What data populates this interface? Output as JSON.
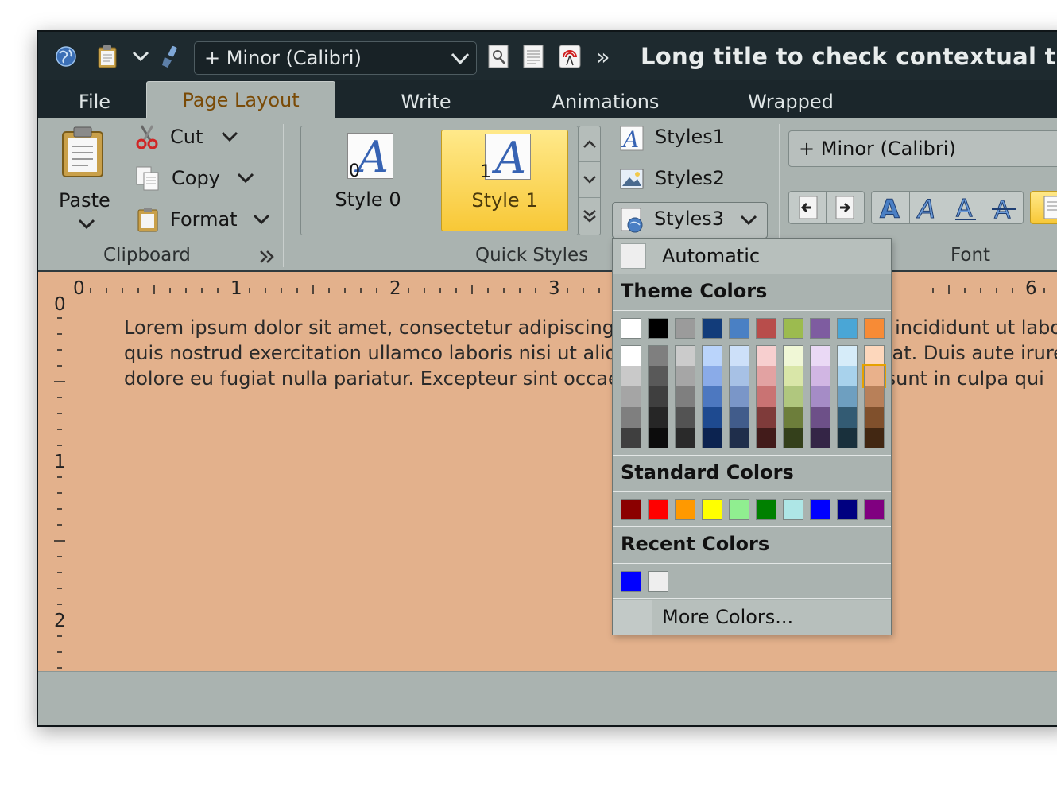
{
  "title_bar": {
    "font_combo": "+ Minor (Calibri)",
    "overflow": "»",
    "title": "Long title to check contextual tabs"
  },
  "tabs": [
    {
      "label": "File",
      "active": false
    },
    {
      "label": "Page Layout",
      "active": true
    },
    {
      "label": "Write",
      "active": false
    },
    {
      "label": "Animations",
      "active": false
    },
    {
      "label": "Wrapped",
      "active": false
    }
  ],
  "clipboard": {
    "paste": "Paste",
    "cut": "Cut",
    "copy": "Copy",
    "format": "Format",
    "group_label": "Clipboard"
  },
  "quick_styles": {
    "items": [
      {
        "num": "0",
        "label": "Style 0",
        "selected": false
      },
      {
        "num": "1",
        "label": "Style 1",
        "selected": true
      }
    ],
    "group_label": "Quick Styles"
  },
  "styles": {
    "styles1": "Styles1",
    "styles2": "Styles2",
    "styles3": "Styles3"
  },
  "font": {
    "combo": "+ Minor (Calibri)",
    "group_label": "Font"
  },
  "ruler": {
    "h_numbers": [
      "0",
      "1",
      "2",
      "3",
      "6"
    ],
    "v_numbers": [
      "0",
      "1",
      "2"
    ]
  },
  "document": {
    "lines": [
      "Lorem ipsum dolor sit amet, consectetur adipiscing elit, sed do eiusmod tempor incididunt ut labore",
      "quis nostrud exercitation ullamco laboris nisi ut aliquip ex ea commodo consequat. Duis aute irure",
      "dolore eu fugiat nulla pariatur. Excepteur sint occaecat cupidatat non proident, sunt in culpa qui"
    ]
  },
  "color_popup": {
    "automatic": "Automatic",
    "theme_header": "Theme Colors",
    "standard_header": "Standard Colors",
    "recent_header": "Recent Colors",
    "more": "More Colors...",
    "theme_top": [
      "#ffffff",
      "#000000",
      "#9b9b9b",
      "#123c7a",
      "#4a80c4",
      "#b84d4b",
      "#9cbb4f",
      "#7e5ca0",
      "#4aa6d6",
      "#f78b36"
    ],
    "theme_shades": [
      [
        "#ffffff",
        "#c9c9c9",
        "#a5a5a5",
        "#7f7f7f",
        "#3f3f3f"
      ],
      [
        "#7f7f7f",
        "#595959",
        "#3f3f3f",
        "#262626",
        "#0c0c0c"
      ],
      [
        "#cbcbcb",
        "#a6a6a6",
        "#7f7f7f",
        "#535353",
        "#2a2a2a"
      ],
      [
        "#bad4fb",
        "#8aabe8",
        "#4d78c0",
        "#1e4a90",
        "#0c2350"
      ],
      [
        "#cde0f9",
        "#a7c1e5",
        "#7a96c8",
        "#415c8b",
        "#1f2e4b"
      ],
      [
        "#f7cfcf",
        "#e2a2a2",
        "#c97373",
        "#7f3b3a",
        "#421b1a"
      ],
      [
        "#f0f7d6",
        "#d9e6a8",
        "#b0c77e",
        "#6d7e3b",
        "#34401b"
      ],
      [
        "#ead9f5",
        "#d1b6e3",
        "#a58cc6",
        "#6d5088",
        "#342546"
      ],
      [
        "#d6ecf9",
        "#a8d2ec",
        "#6e9fc0",
        "#335b73",
        "#19303c"
      ],
      [
        "#fdd7bc",
        "#e9b18b",
        "#b88059",
        "#80502c",
        "#422712"
      ]
    ],
    "standard": [
      "#8b0000",
      "#ff0000",
      "#ff9900",
      "#ffff00",
      "#90ee90",
      "#008000",
      "#aee6e6",
      "#0000ff",
      "#000080",
      "#800080"
    ],
    "recent": [
      "#0000ff",
      "#eeeeee"
    ]
  }
}
